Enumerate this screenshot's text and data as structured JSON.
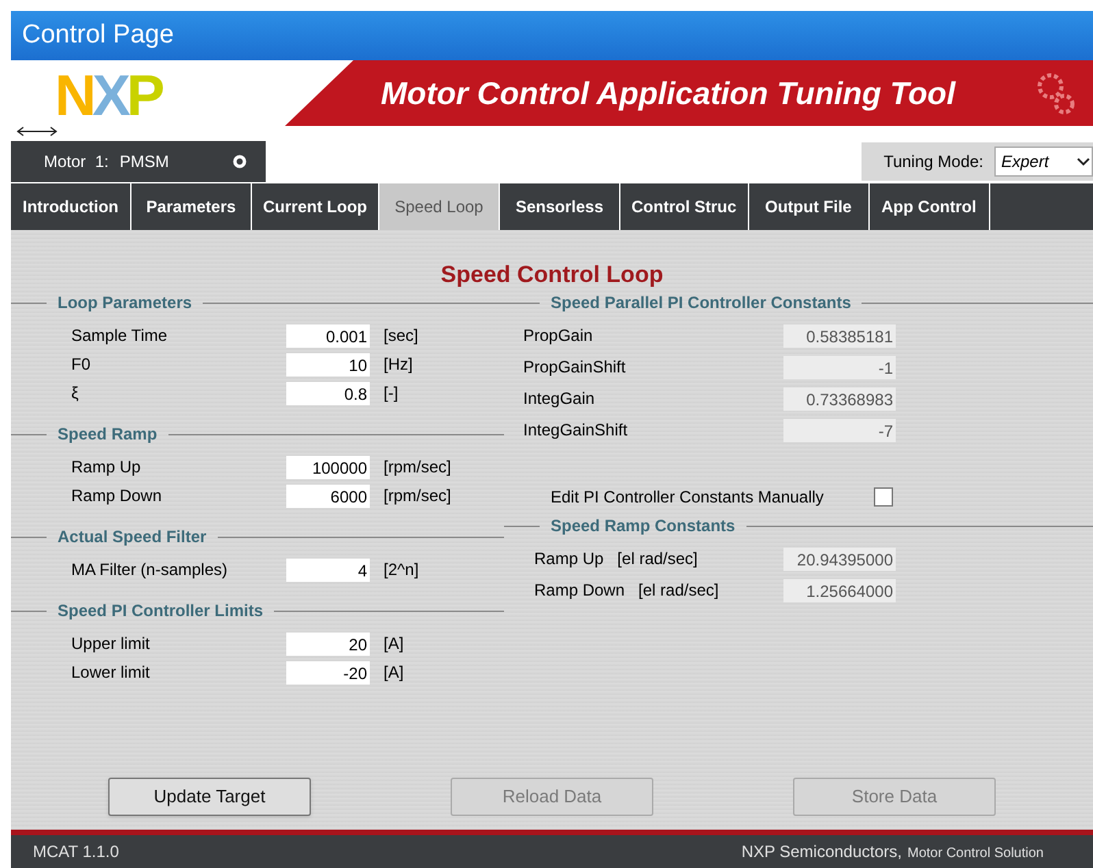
{
  "window": {
    "title": "Control Page"
  },
  "header": {
    "logo": "NXP",
    "title": "Motor Control Application Tuning Tool"
  },
  "motor": {
    "label": "Motor  1:",
    "type": "PMSM"
  },
  "tuning_mode": {
    "label": "Tuning Mode:",
    "value": "Expert"
  },
  "tabs": [
    {
      "label": "Introduction",
      "selected": false
    },
    {
      "label": "Parameters",
      "selected": false
    },
    {
      "label": "Current Loop",
      "selected": false
    },
    {
      "label": "Speed Loop",
      "selected": true
    },
    {
      "label": "Sensorless",
      "selected": false
    },
    {
      "label": "Control Struc",
      "selected": false
    },
    {
      "label": "Output File",
      "selected": false
    },
    {
      "label": "App Control",
      "selected": false
    }
  ],
  "page_title": "Speed Control Loop",
  "left_groups": [
    {
      "title": "Loop Parameters",
      "fields": [
        {
          "label": "Sample Time",
          "value": "0.001",
          "unit": "[sec]"
        },
        {
          "label": "F0",
          "value": "10",
          "unit": "[Hz]"
        },
        {
          "label": "ξ",
          "value": "0.8",
          "unit": "[-]"
        }
      ]
    },
    {
      "title": "Speed Ramp",
      "fields": [
        {
          "label": "Ramp Up",
          "value": "100000",
          "unit": "[rpm/sec]"
        },
        {
          "label": "Ramp Down",
          "value": "6000",
          "unit": "[rpm/sec]"
        }
      ]
    },
    {
      "title": "Actual Speed Filter",
      "fields": [
        {
          "label": "MA Filter (n-samples)",
          "value": "4",
          "unit": "[2^n]"
        }
      ]
    },
    {
      "title": "Speed PI Controller Limits",
      "fields": [
        {
          "label": "Upper limit",
          "value": "20",
          "unit": "[A]"
        },
        {
          "label": "Lower limit",
          "value": "-20",
          "unit": "[A]"
        }
      ]
    }
  ],
  "pi_constants": {
    "title": "Speed Parallel PI Controller Constants",
    "fields": [
      {
        "label": "PropGain",
        "value": "0.58385181"
      },
      {
        "label": "PropGainShift",
        "value": "-1"
      },
      {
        "label": "IntegGain",
        "value": "0.73368983"
      },
      {
        "label": "IntegGainShift",
        "value": "-7"
      }
    ]
  },
  "edit_manually": {
    "label": "Edit PI Controller Constants Manually",
    "checked": false
  },
  "ramp_constants": {
    "title": "Speed Ramp Constants",
    "fields": [
      {
        "label": "Ramp Up   [el rad/sec]",
        "value": "20.94395000"
      },
      {
        "label": "Ramp Down   [el rad/sec]",
        "value": "1.25664000"
      }
    ]
  },
  "buttons": [
    {
      "label": "Update Target",
      "disabled": false
    },
    {
      "label": "Reload Data",
      "disabled": true
    },
    {
      "label": "Store Data",
      "disabled": true
    }
  ],
  "status_bar": {
    "version": "MCAT 1.1.0",
    "company": "NXP Semiconductors,",
    "product": "Motor Control Solution"
  }
}
